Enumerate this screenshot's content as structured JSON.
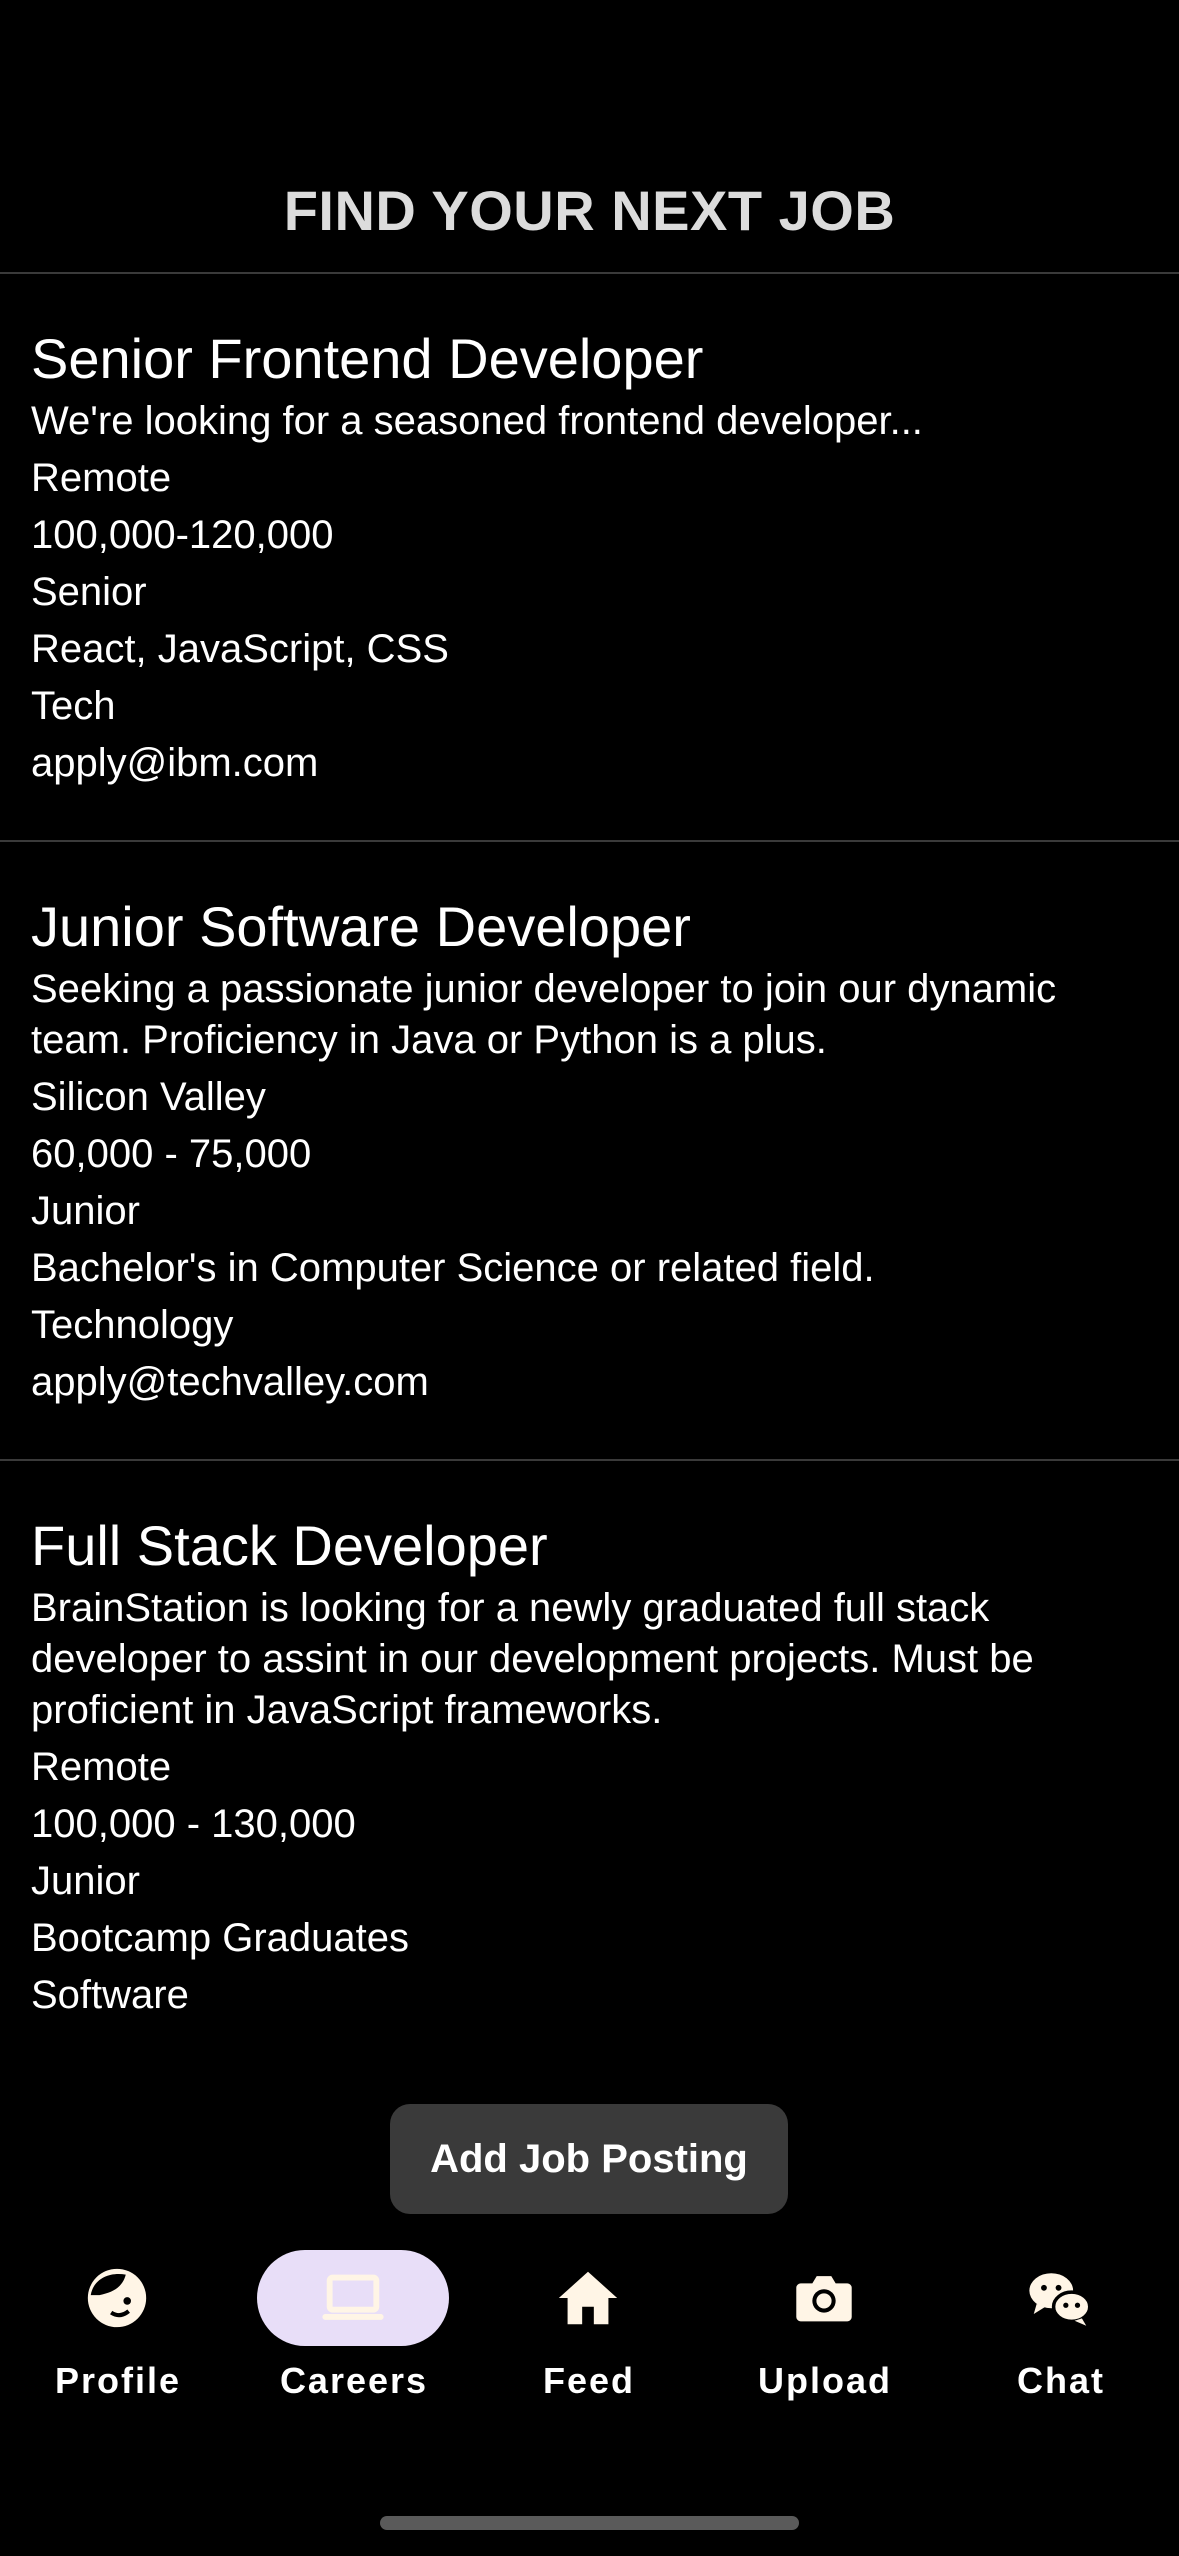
{
  "header": {
    "title": "FIND YOUR NEXT JOB"
  },
  "jobs": [
    {
      "title": "Senior Frontend Developer",
      "description": "We're looking for a seasoned frontend developer...",
      "location": "Remote",
      "salary": "100,000-120,000",
      "level": "Senior",
      "requirements": "React, JavaScript, CSS",
      "industry": "Tech",
      "contact": "apply@ibm.com"
    },
    {
      "title": "Junior Software Developer",
      "description": "Seeking a passionate junior developer to join our dynamic team. Proficiency in Java or Python is a plus.",
      "location": "Silicon Valley",
      "salary": "60,000 - 75,000",
      "level": "Junior",
      "requirements": "Bachelor's in Computer Science or related field.",
      "industry": "Technology",
      "contact": "apply@techvalley.com"
    },
    {
      "title": "Full Stack Developer",
      "description": "BrainStation is looking for a newly graduated full stack developer to assint in our development projects. Must be proficient in JavaScript frameworks.",
      "location": "Remote",
      "salary": "100,000 - 130,000",
      "level": "Junior",
      "requirements": "Bootcamp Graduates",
      "industry": "Software",
      "contact": ""
    }
  ],
  "actions": {
    "add_job_label": "Add Job Posting"
  },
  "tabbar": {
    "active": "Careers",
    "accent_color": "#e8def8",
    "items": [
      {
        "label": "Profile",
        "icon": "face-icon"
      },
      {
        "label": "Careers",
        "icon": "laptop-icon"
      },
      {
        "label": "Feed",
        "icon": "home-icon"
      },
      {
        "label": "Upload",
        "icon": "camera-icon"
      },
      {
        "label": "Chat",
        "icon": "wechat-icon"
      }
    ]
  }
}
